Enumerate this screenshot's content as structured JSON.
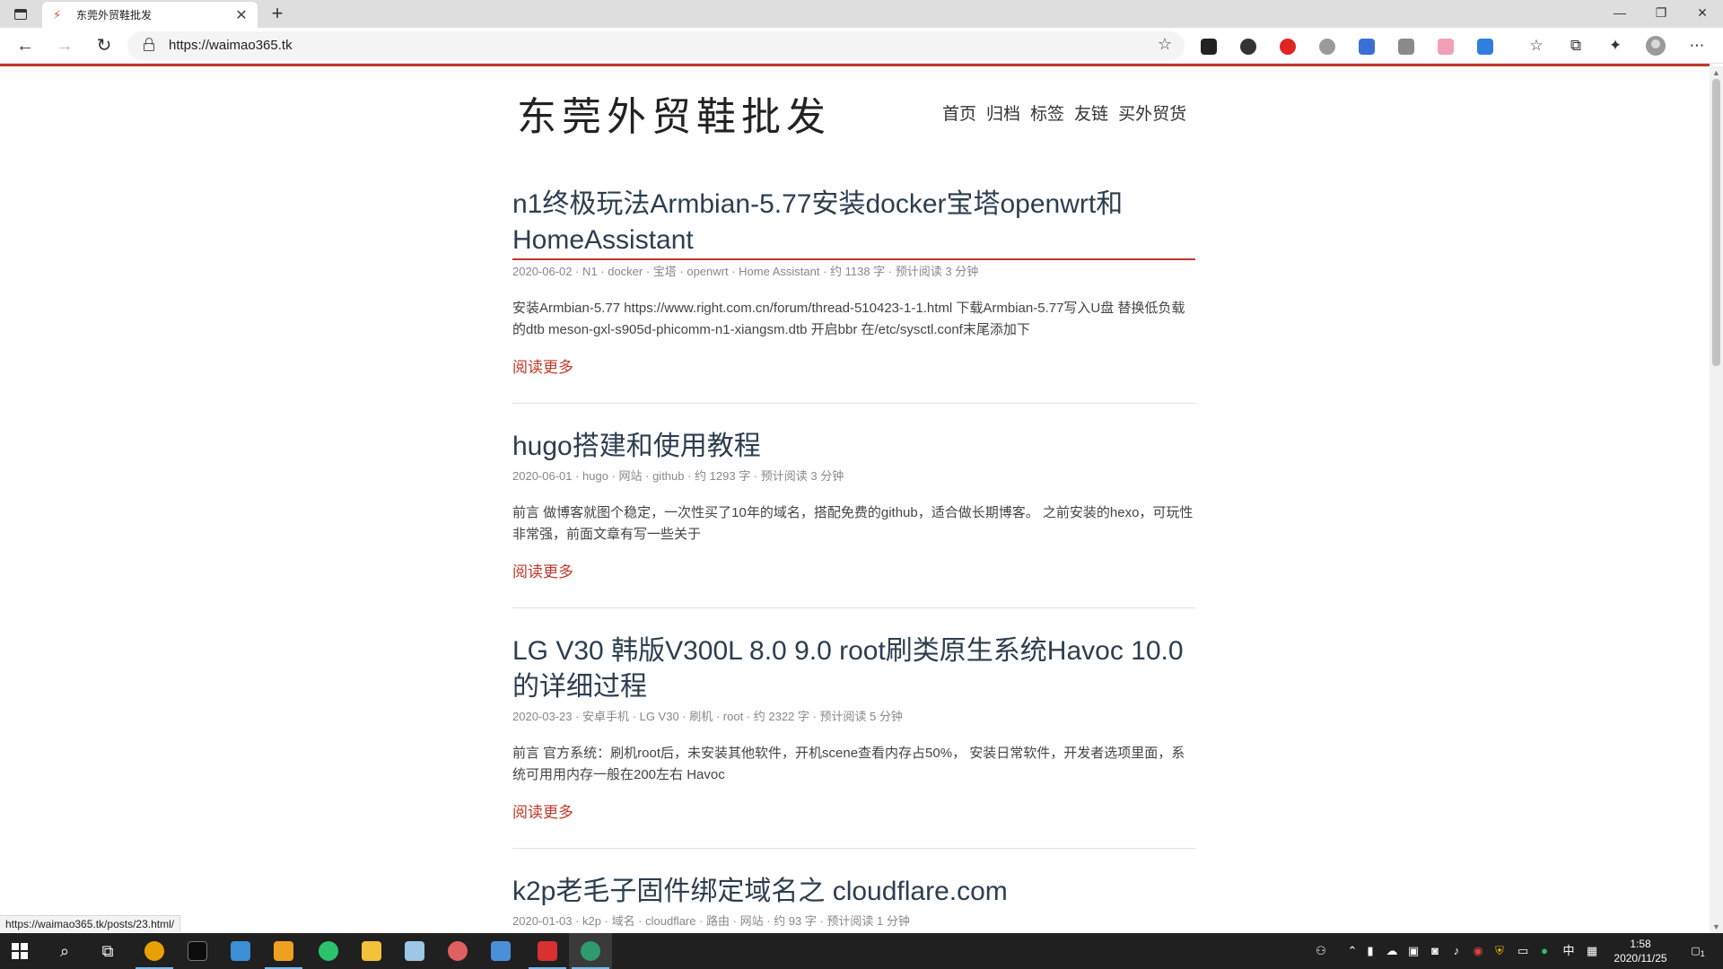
{
  "browser": {
    "tab_title": "东莞外贸鞋批发",
    "url": "https://waimao365.tk",
    "status_url": "https://waimao365.tk/posts/23.html/"
  },
  "site": {
    "title": "东莞外贸鞋批发",
    "nav": [
      "首页",
      "归档",
      "标签",
      "友链",
      "买外贸货"
    ]
  },
  "posts": [
    {
      "title": "n1终极玩法Armbian-5.77安装docker宝塔openwrt和HomeAssistant",
      "meta": "2020-06-02 · N1 · docker · 宝塔 · openwrt · Home Assistant · 约 1138 字 · 预计阅读 3 分钟",
      "excerpt": "安装Armbian-5.77 https://www.right.com.cn/forum/thread-510423-1-1.html 下载Armbian-5.77写入U盘 替换低负载的dtb meson-gxl-s905d-phicomm-n1-xiangsm.dtb 开启bbr 在/etc/sysctl.conf末尾添加下",
      "read_more": "阅读更多"
    },
    {
      "title": "hugo搭建和使用教程",
      "meta": "2020-06-01 · hugo · 网站 · github · 约 1293 字 · 预计阅读 3 分钟",
      "excerpt": "前言 做博客就图个稳定，一次性买了10年的域名，搭配免费的github，适合做长期博客。 之前安装的hexo，可玩性非常强，前面文章有写一些关于",
      "read_more": "阅读更多"
    },
    {
      "title": "LG V30 韩版V300L 8.0 9.0 root刷类原生系统Havoc 10.0的详细过程",
      "meta": "2020-03-23 · 安卓手机 · LG V30 · 刷机 · root · 约 2322 字 · 预计阅读 5 分钟",
      "excerpt": "前言 官方系统：刷机root后，未安装其他软件，开机scene查看内存占50%， 安装日常软件，开发者选项里面，系统可用用内存一般在200左右 Havoc",
      "read_more": "阅读更多"
    },
    {
      "title": "k2p老毛子固件绑定域名之 cloudflare.com",
      "meta": "2020-01-03 · k2p · 域名 · cloudflare · 路由 · 网站 · 约 93 字 · 预计阅读 1 分钟"
    }
  ],
  "taskbar": {
    "time": "1:58",
    "date": "2020/11/25",
    "ime": "中",
    "notification_count": "1"
  },
  "colors": {
    "accent": "#c0392b",
    "title_text": "#2c3e50",
    "taskbar_bg": "#202020"
  }
}
